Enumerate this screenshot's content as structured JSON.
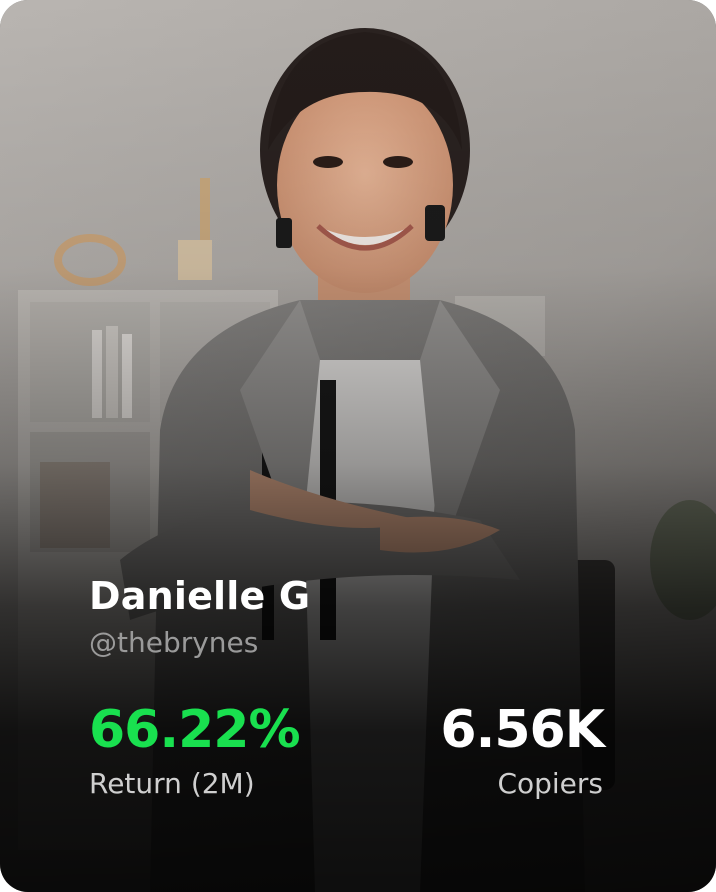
{
  "trader": {
    "name": "Danielle G",
    "handle": "@thebrynes"
  },
  "stats": {
    "return_value": "66.22%",
    "return_label": "Return (2M)",
    "copiers_value": "6.56K",
    "copiers_label": "Copiers"
  },
  "colors": {
    "positive": "#19e04f",
    "text_primary": "#ffffff",
    "text_muted": "#9a9a9a"
  }
}
